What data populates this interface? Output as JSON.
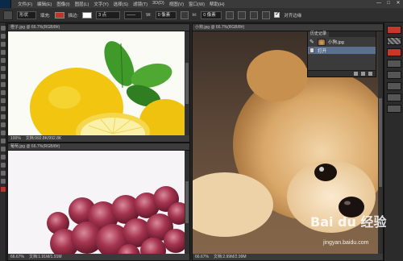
{
  "menubar": {
    "items": [
      "文件(F)",
      "编辑(E)",
      "图像(I)",
      "图层(L)",
      "文字(Y)",
      "选择(S)",
      "滤镜(T)",
      "3D(D)",
      "视图(V)",
      "窗口(W)",
      "帮助(H)"
    ],
    "window_buttons": [
      "—",
      "□",
      "✕"
    ]
  },
  "options_bar": {
    "shape_mode": "形状",
    "fill_label": "填充:",
    "stroke_label": "描边:",
    "stroke_width": "3 点",
    "width_label": "W:",
    "width_value": "0 像素",
    "height_label": "H:",
    "height_value": "0 像素",
    "align_edges_label": "对齐边缘",
    "fill_color": "#c0342a",
    "stroke_color": "#ffffff"
  },
  "documents": {
    "lemon": {
      "tab": "橙子.jpg @ 66.7%(RGB/8#)",
      "zoom": "100%",
      "doc_size": "文档:992.8K/992.8K"
    },
    "grape": {
      "tab": "葡萄.jpg @ 66.7%(RGB/8#)",
      "zoom": "66.67%",
      "doc_size": "文档:1.91M/1.91M"
    },
    "puppy": {
      "tab": "小狗.jpg @ 66.7%(RGB/8#)",
      "zoom": "66.67%",
      "doc_size": "文档:2.99M/2.99M"
    }
  },
  "history_panel": {
    "tab_label": "历史记录",
    "snapshot_label": "小狗.jpg",
    "step_label": "打开",
    "bottom_icons": [
      "new-document-from-state-icon",
      "camera-snapshot-icon",
      "trash-icon"
    ]
  },
  "watermark": {
    "brand": "Bai du 经验",
    "url": "jingyan.baidu.com"
  }
}
